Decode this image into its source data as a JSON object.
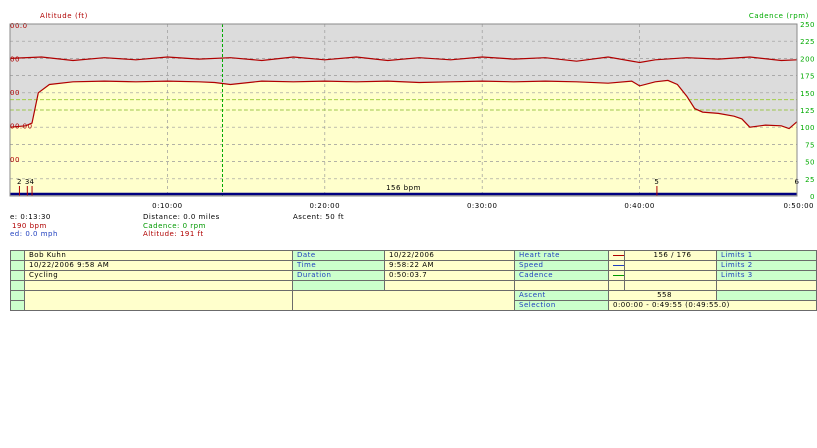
{
  "chart_data": {
    "type": "line",
    "left_axis_title": "Altitude (ft)",
    "right_axis_title": "Cadence (rpm)",
    "left_tick_labels": [
      "00.0",
      "00",
      "00",
      "00.00",
      "00"
    ],
    "right_ticks": [
      "250",
      "225",
      "200",
      "175",
      "150",
      "125",
      "100",
      "75",
      "50",
      "25",
      "0"
    ],
    "right_ylim": [
      0,
      250
    ],
    "x_ticks": [
      "0:10:00",
      "0:20:00",
      "0:30:00",
      "0:40:00",
      "0:50:00"
    ],
    "x_range_minutes": [
      0,
      50
    ],
    "markers": [
      {
        "label": "2",
        "minute": 0.6
      },
      {
        "label": "3",
        "minute": 1.1
      },
      {
        "label": "4",
        "minute": 1.4
      },
      {
        "label": "5",
        "minute": 41.1
      },
      {
        "label": "6",
        "minute": 50
      }
    ],
    "avg_label": "156 bpm",
    "cursor_minute": 13.5,
    "limit_band": [
      125,
      140
    ],
    "series": [
      {
        "name": "Heart rate",
        "color": "#b00000",
        "points": [
          [
            0,
            100
          ],
          [
            1,
            102
          ],
          [
            1.4,
            106
          ],
          [
            1.8,
            150
          ],
          [
            2.5,
            162
          ],
          [
            4,
            166
          ],
          [
            6,
            167
          ],
          [
            8,
            166
          ],
          [
            10,
            167
          ],
          [
            12,
            166
          ],
          [
            13,
            165
          ],
          [
            14,
            162
          ],
          [
            16,
            167
          ],
          [
            18,
            166
          ],
          [
            20,
            167
          ],
          [
            22,
            166
          ],
          [
            24,
            167
          ],
          [
            26,
            165
          ],
          [
            28,
            166
          ],
          [
            30,
            167
          ],
          [
            32,
            166
          ],
          [
            34,
            167
          ],
          [
            36,
            166
          ],
          [
            38,
            164
          ],
          [
            39.5,
            167
          ],
          [
            40,
            160
          ],
          [
            41,
            166
          ],
          [
            41.8,
            168
          ],
          [
            42.4,
            162
          ],
          [
            43,
            145
          ],
          [
            43.5,
            127
          ],
          [
            44,
            122
          ],
          [
            45,
            120
          ],
          [
            46,
            116
          ],
          [
            46.5,
            112
          ],
          [
            47,
            100
          ],
          [
            48,
            103
          ],
          [
            49,
            102
          ],
          [
            49.5,
            98
          ],
          [
            50,
            108
          ]
        ]
      },
      {
        "name": "Speed",
        "color": "#b00000",
        "points": [
          [
            0,
            200
          ],
          [
            2,
            202
          ],
          [
            4,
            197
          ],
          [
            6,
            201
          ],
          [
            8,
            198
          ],
          [
            10,
            202
          ],
          [
            12,
            199
          ],
          [
            14,
            201
          ],
          [
            16,
            197
          ],
          [
            18,
            202
          ],
          [
            20,
            198
          ],
          [
            22,
            202
          ],
          [
            24,
            197
          ],
          [
            26,
            201
          ],
          [
            28,
            198
          ],
          [
            30,
            202
          ],
          [
            32,
            199
          ],
          [
            34,
            201
          ],
          [
            36,
            196
          ],
          [
            38,
            202
          ],
          [
            40,
            194
          ],
          [
            41,
            198
          ],
          [
            43,
            201
          ],
          [
            45,
            199
          ],
          [
            47,
            202
          ],
          [
            49,
            197
          ],
          [
            50,
            198
          ]
        ]
      }
    ]
  },
  "readout": {
    "time": "e: 0:13:30",
    "hr": "190 bpm",
    "speed": "ed: 0.0 mph",
    "distance": "Distance: 0.0 miles",
    "cadence": "Cadence: 0 rpm",
    "altitude": "Altitude: 191 ft",
    "ascent": "Ascent: 50 ft"
  },
  "summary": {
    "name": "Bob Kuhn",
    "datetime": "10/22/2006 9:58 AM",
    "sport": "Cycling",
    "date_label": "Date",
    "date_value": "10/22/2006",
    "time_label": "Time",
    "time_value": "9:58:22 AM",
    "duration_label": "Duration",
    "duration_value": "0:50:03.7",
    "hr_label": "Heart rate",
    "hr_value": "156 / 176",
    "speed_label": "Speed",
    "cadence_label": "Cadence",
    "ascent_label": "Ascent",
    "ascent_value": "558",
    "selection_label": "Selection",
    "selection_value": "0:00:00 - 0:49:55 (0:49:55.0)",
    "limits1": "Limits 1",
    "limits2": "Limits 2",
    "limits3": "Limits 3",
    "colors": {
      "hr": "#b00000",
      "speed": "#1f3fbf",
      "cadence": "#009900"
    }
  }
}
